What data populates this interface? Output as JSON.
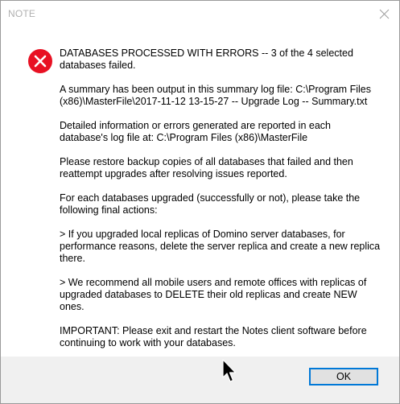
{
  "dialog": {
    "title": "NOTE",
    "icon": "error-icon",
    "messages": [
      "DATABASES PROCESSED WITH ERRORS -- 3 of the 4 selected databases failed.",
      "A summary has been output in this summary log file: C:\\Program Files (x86)\\MasterFile\\2017-11-12 13-15-27 -- Upgrade Log -- Summary.txt",
      "Detailed information or errors generated are reported in each database's log file at: C:\\Program Files (x86)\\MasterFile",
      "Please restore backup copies of all databases that failed and then reattempt upgrades after resolving issues reported.",
      "For each databases upgraded (successfully or not), please take the following final actions:",
      ">  If you upgraded local replicas of Domino server databases, for performance reasons, delete the server replica and create a new replica there.",
      ">  We recommend all mobile users and remote offices with replicas of upgraded databases to DELETE their old replicas and create NEW ones.",
      "IMPORTANT: Please exit and restart the Notes client software before continuing to work with your databases."
    ],
    "ok_label": "OK"
  },
  "colors": {
    "error_red": "#e81123",
    "accent_blue": "#0078d7",
    "footer_bg": "#f0f0f0"
  }
}
